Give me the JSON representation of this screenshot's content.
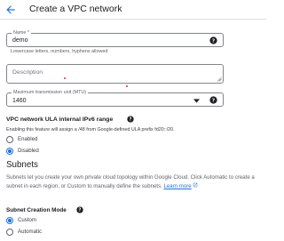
{
  "header": {
    "title": "Create a VPC network"
  },
  "name_field": {
    "label": "Name *",
    "value": "demo",
    "hint": "Lowercase letters, numbers, hyphens allowed"
  },
  "description_field": {
    "placeholder": "Description"
  },
  "mtu_field": {
    "label": "Maximum transmission unit (MTU)",
    "value": "1460"
  },
  "ula": {
    "heading": "VPC network ULA internal IPv6 range",
    "description": "Enabling this feature will assign a /48 from Google-defined ULA prefix fd20::/20.",
    "options": [
      {
        "label": "Enabled",
        "checked": false
      },
      {
        "label": "Disabled",
        "checked": true
      }
    ]
  },
  "subnets": {
    "heading": "Subnets",
    "description": "Subnets let you create your own private cloud topology within Google Cloud. Click Automatic to create a subnet in each region, or Custom to manually define the subnets.",
    "learn_more": "Learn more",
    "mode_label": "Subnet Creation Mode",
    "options": [
      {
        "label": "Custom",
        "checked": true
      },
      {
        "label": "Automatic",
        "checked": false
      }
    ]
  },
  "colors": {
    "accent": "#1a73e8",
    "error": "#d93025",
    "text": "#202124",
    "muted": "#5f6368"
  }
}
